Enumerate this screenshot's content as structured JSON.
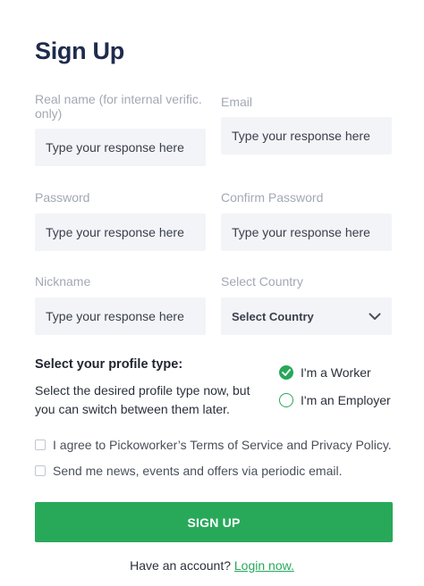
{
  "page": {
    "title": "Sign Up"
  },
  "form": {
    "real_name": {
      "label": "Real name (for internal verific. only)",
      "placeholder": "Type your response here"
    },
    "email": {
      "label": "Email",
      "placeholder": "Type your response here"
    },
    "password": {
      "label": "Password",
      "placeholder": "Type your response here"
    },
    "confirm_password": {
      "label": "Confirm Password",
      "placeholder": "Type your response here"
    },
    "nickname": {
      "label": "Nickname",
      "placeholder": "Type your response here"
    },
    "country": {
      "label": "Select Country",
      "selected": "Select Country",
      "icon": "chevron-down-icon"
    }
  },
  "profile_type": {
    "heading": "Select your profile type:",
    "description": "Select the desired profile type now, but you can switch between them later.",
    "options": [
      {
        "label": "I'm a Worker",
        "checked": true
      },
      {
        "label": "I'm an Employer",
        "checked": false
      }
    ]
  },
  "agreements": {
    "terms": "I agree to Pickoworker’s Terms of Service and Privacy Policy.",
    "newsletter": "Send me news, events and offers via periodic email."
  },
  "submit": {
    "label": "SIGN UP"
  },
  "footer": {
    "prompt": "Have an account?",
    "link": "Login now."
  },
  "colors": {
    "accent": "#28a95a",
    "title": "#1f2b4d",
    "label": "#a3a8b4",
    "input_bg": "#f3f4f8"
  }
}
